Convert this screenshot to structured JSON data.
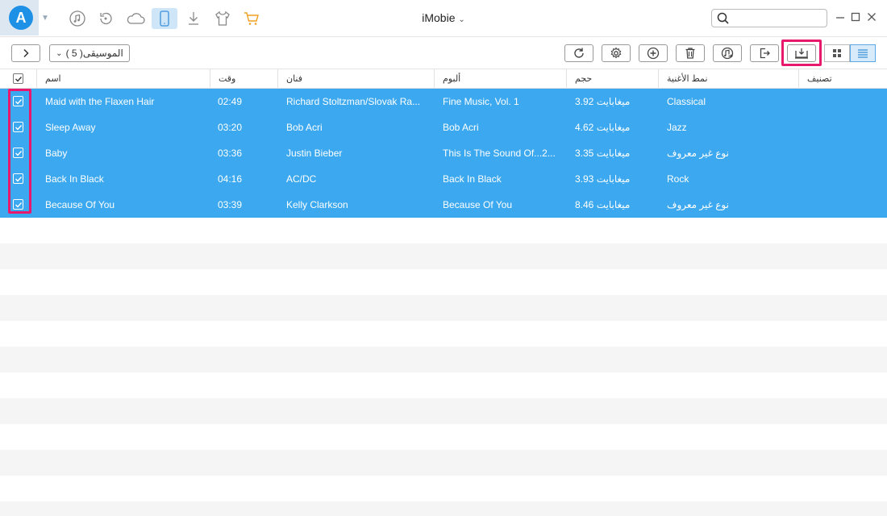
{
  "app": {
    "title": "iMobie",
    "logo_letter": "A"
  },
  "search": {
    "placeholder": "",
    "value": ""
  },
  "toolbar": {
    "category_label": "الموسيقى( 5 )"
  },
  "columns": {
    "name": "اسم",
    "time": "وقت",
    "artist": "فنان",
    "album": "ألبوم",
    "size": "حجم",
    "genre": "نمط الأغنية",
    "rating": "تصنيف"
  },
  "songs": [
    {
      "name": "Maid with the Flaxen Hair",
      "time": "02:49",
      "artist": "Richard Stoltzman/Slovak Ra...",
      "album": "Fine Music, Vol. 1",
      "size": "3.92 ميغابايت",
      "genre": "Classical"
    },
    {
      "name": "Sleep Away",
      "time": "03:20",
      "artist": "Bob Acri",
      "album": "Bob Acri",
      "size": "4.62 ميغابايت",
      "genre": "Jazz"
    },
    {
      "name": "Baby",
      "time": "03:36",
      "artist": "Justin Bieber",
      "album": "This Is The Sound Of...2...",
      "size": "3.35 ميغابايت",
      "genre": "نوع غير معروف"
    },
    {
      "name": "Back In Black",
      "time": "04:16",
      "artist": "AC/DC",
      "album": "Back In Black",
      "size": "3.93 ميغابايت",
      "genre": "Rock"
    },
    {
      "name": "Because Of You",
      "time": "03:39",
      "artist": "Kelly Clarkson",
      "album": "Because Of You",
      "size": "8.46 ميغابايت",
      "genre": "نوع غير معروف"
    }
  ],
  "icons": {
    "nav": [
      "music-icon",
      "restore-icon",
      "cloud-icon",
      "phone-icon",
      "download-icon",
      "tshirt-icon",
      "cart-icon"
    ],
    "toolbar": [
      "refresh-icon",
      "settings-icon",
      "add-icon",
      "delete-icon",
      "to-itunes-icon",
      "export-icon",
      "to-computer-icon",
      "grid-view-icon",
      "list-view-icon"
    ]
  },
  "colors": {
    "accent": "#1e90e6",
    "selected_row": "#3ba8ef",
    "highlight": "#e8186d",
    "cart": "#f0a020"
  }
}
